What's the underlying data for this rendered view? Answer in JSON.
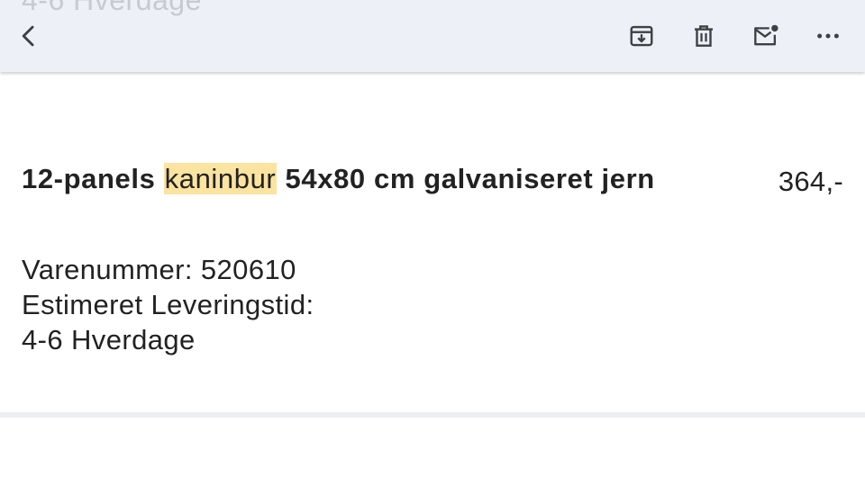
{
  "toolbar": {
    "ghost_text": "4-6 Hverdage",
    "icons": {
      "back": "chevron-left-icon",
      "archive": "archive-icon",
      "delete": "trash-icon",
      "mark_unread": "mail-unread-icon",
      "more": "more-horizontal-icon"
    }
  },
  "item": {
    "title_prefix": "12-panels ",
    "title_highlight": "kaninbur",
    "title_suffix": " 54x80 cm galvaniseret jern",
    "price": "364,-",
    "item_number": "Varenummer: 520610",
    "delivery_label": "Estimeret Leveringstid:",
    "delivery_value": "4-6 Hverdage"
  },
  "colors": {
    "toolbar_bg": "#edf0f6",
    "highlight": "#fbe3a0",
    "text": "#222222",
    "icon": "#3c4043"
  }
}
